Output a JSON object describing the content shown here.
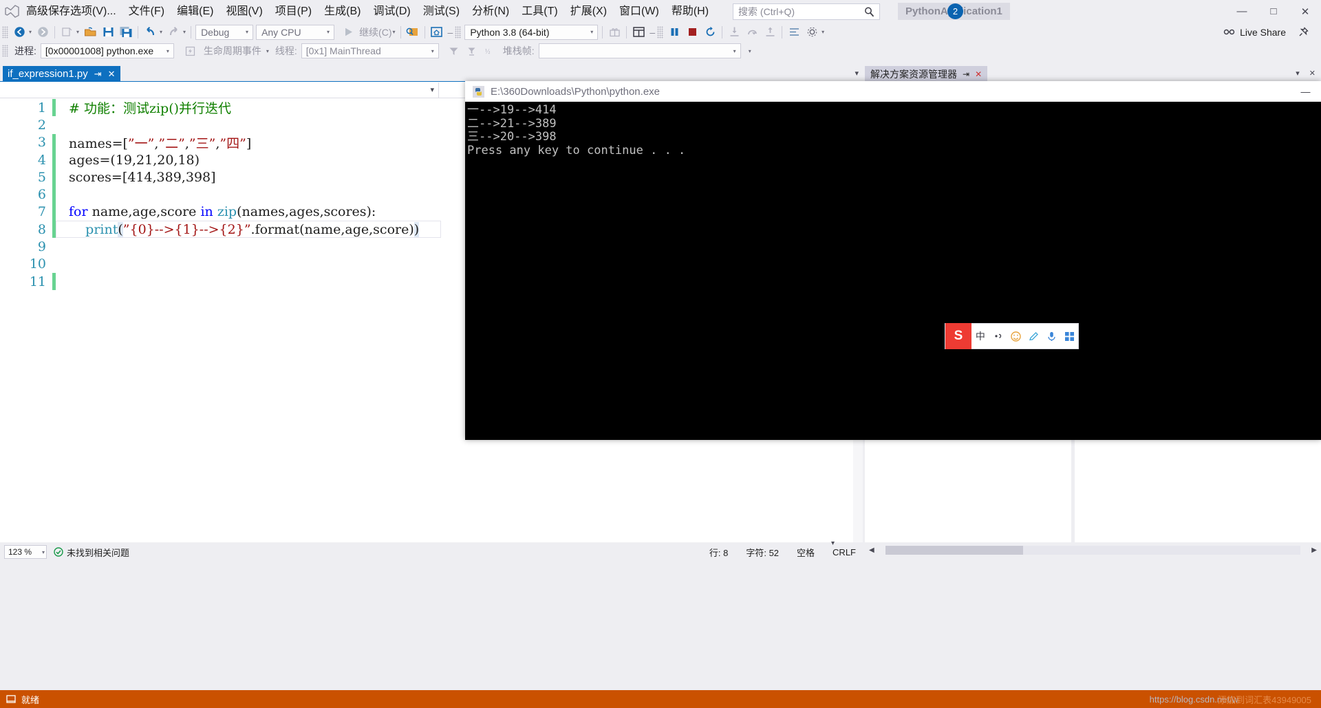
{
  "window": {
    "project_chip": "PythonApplication1",
    "notification_count": "2",
    "controls": {
      "minimize": "—",
      "maximize": "□",
      "close": "✕"
    }
  },
  "menubar": {
    "logo_icon": "visual-studio-logo-icon",
    "items": [
      "高级保存选项(V)...",
      "文件(F)",
      "编辑(E)",
      "视图(V)",
      "项目(P)",
      "生成(B)",
      "调试(D)",
      "测试(S)",
      "分析(N)",
      "工具(T)",
      "扩展(X)",
      "窗口(W)",
      "帮助(H)"
    ],
    "search_placeholder": "搜索 (Ctrl+Q)",
    "search_icon": "magnifier-icon"
  },
  "toolbar": {
    "nav_back_icon": "navigate-back-icon",
    "nav_forward_icon": "navigate-forward-icon",
    "new_project_icon": "new-project-icon",
    "open_file_icon": "open-file-icon",
    "save_icon": "save-icon",
    "save_all_icon": "save-all-icon",
    "undo_icon": "undo-icon",
    "redo_icon": "redo-icon",
    "config_value": "Debug",
    "platform_value": "Any CPU",
    "start_icon": "start-play-icon",
    "continue_label": "继续(C)",
    "attach_icon": "attach-to-process-icon",
    "home_icon": "home-icon",
    "interpreter_value": "Python 3.8 (64-bit)",
    "gift_icon": "gift-icon",
    "layout_icon": "window-layout-icon",
    "pause_icon": "pause-icon",
    "stop_icon": "stop-icon",
    "restart_icon": "restart-icon",
    "step_into_icon": "step-into-icon",
    "step_over_icon": "step-over-icon",
    "step_out_icon": "step-out-icon",
    "diff_icon": "compare-icon",
    "settings_icon": "settings-icon",
    "live_share_label": "Live Share",
    "live_share_icon": "live-share-icon",
    "pin_icon": "pin-icon"
  },
  "debugbar": {
    "process_label": "进程:",
    "process_value": "[0x00001008] python.exe",
    "lifecycle_icon": "lifecycle-events-icon",
    "lifecycle_label": "生命周期事件",
    "thread_label": "线程:",
    "thread_value": "[0x1] MainThread",
    "filter_icon": "filter-icon",
    "collapse_icon": "collapse-icon",
    "unwind_icon": "unwind-icon",
    "stackframe_label": "堆栈帧:",
    "stackframe_value": ""
  },
  "editor": {
    "tab_label": "if_expression1.py",
    "tab_pin_icon": "pin-icon",
    "tab_close_icon": "close-icon",
    "tab_overflow_icon": "chevron-down-icon",
    "nav_type_value": "",
    "nav_member_value": "",
    "lines": [
      {
        "n": "1",
        "changed": true,
        "tokens": [
          {
            "t": "# 功能：测试zip()并行迭代",
            "c": "tk-com"
          }
        ]
      },
      {
        "n": "2",
        "changed": false,
        "tokens": []
      },
      {
        "n": "3",
        "changed": true,
        "tokens": [
          {
            "t": "names=[",
            "c": ""
          },
          {
            "t": "”一”",
            "c": "tk-str"
          },
          {
            "t": ",",
            "c": ""
          },
          {
            "t": "”二”",
            "c": "tk-str"
          },
          {
            "t": ",",
            "c": ""
          },
          {
            "t": "”三”",
            "c": "tk-str"
          },
          {
            "t": ",",
            "c": ""
          },
          {
            "t": "”四”",
            "c": "tk-str"
          },
          {
            "t": "]",
            "c": ""
          }
        ]
      },
      {
        "n": "4",
        "changed": true,
        "tokens": [
          {
            "t": "ages=(19,21,20,18)",
            "c": ""
          }
        ]
      },
      {
        "n": "5",
        "changed": true,
        "tokens": [
          {
            "t": "scores=[414,389,398]",
            "c": ""
          }
        ]
      },
      {
        "n": "6",
        "changed": true,
        "tokens": []
      },
      {
        "n": "7",
        "changed": true,
        "tokens": [
          {
            "t": "for",
            "c": "tk-kw"
          },
          {
            "t": " name,age,score ",
            "c": ""
          },
          {
            "t": "in",
            "c": "tk-kw"
          },
          {
            "t": " ",
            "c": ""
          },
          {
            "t": "zip",
            "c": "tk-fn"
          },
          {
            "t": "(names,ages,scores):",
            "c": ""
          }
        ]
      },
      {
        "n": "8",
        "changed": true,
        "tokens": [
          {
            "t": "    ",
            "c": ""
          },
          {
            "t": "print",
            "c": "tk-fn"
          },
          {
            "t": "(",
            "c": "tk-brace-hl"
          },
          {
            "t": "”{0}-->{1}-->{2}”",
            "c": "tk-str"
          },
          {
            "t": ".format(name,age,score)",
            "c": ""
          },
          {
            "t": ")",
            "c": "tk-brace-hl"
          }
        ]
      },
      {
        "n": "9",
        "changed": false,
        "tokens": []
      },
      {
        "n": "10",
        "changed": false,
        "tokens": []
      },
      {
        "n": "11",
        "changed": true,
        "tokens": []
      }
    ]
  },
  "solution_explorer": {
    "tab_label": "解决方案资源管理器",
    "pin_icon": "pin-icon",
    "close_icon": "close-icon",
    "overflow_icon": "chevron-down-icon",
    "close2_icon": "close-icon"
  },
  "status": {
    "zoom_value": "123 %",
    "zoom_caret_icon": "chevron-down-icon",
    "ok_icon": "check-circle-icon",
    "issues_text": "未找到相关问题",
    "line_label": "行: 8",
    "col_label": "字符: 52",
    "space_label": "空格",
    "eol_label": "CRLF"
  },
  "vs_statusbar": {
    "icon": "ready-icon",
    "text": "就绪",
    "watermark_right": "添加到词汇表43949005",
    "watermark_url": "https://blog.csdn.net/w"
  },
  "console": {
    "title": "E:\\360Downloads\\Python\\python.exe",
    "title_icon": "python-exe-icon",
    "minimize": "—",
    "maximize": "□",
    "close": "✕",
    "output_lines": [
      "一-->19-->414",
      "二-->21-->389",
      "三-->20-->398",
      "Press any key to continue . . ."
    ]
  },
  "ime_bar": {
    "logo_icon": "sogou-ime-icon",
    "logo_text": "S",
    "mode_label": "中",
    "items": [
      {
        "icon": "pinyin-switch-icon",
        "glyph": "•,"
      },
      {
        "icon": "emoji-icon",
        "glyph": "☺"
      },
      {
        "icon": "pen-icon",
        "glyph": "✎"
      },
      {
        "icon": "microphone-icon",
        "glyph": "Ἲ4"
      },
      {
        "icon": "toolbox-icon",
        "glyph": "⊞"
      }
    ]
  }
}
